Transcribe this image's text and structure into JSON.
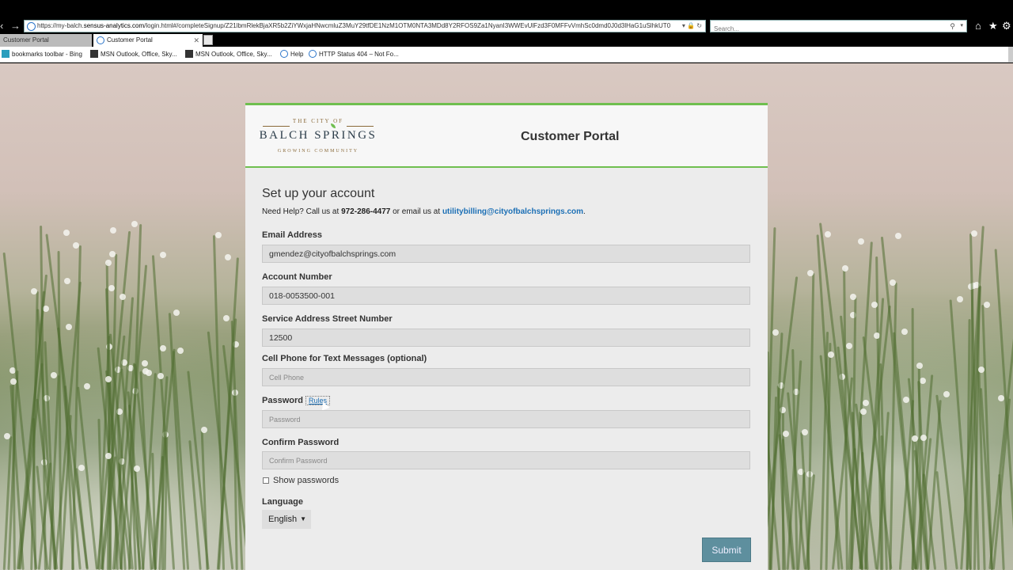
{
  "browser": {
    "url_prefix": "https://my-balch.",
    "url_domain": "sensus-analytics.com",
    "url_path": "/login.html#/completeSignup/Z21lbmRlekBjaXR5b2ZiYWxjaHNwcmluZ3MuY29tfDE1NzM1OTM0NTA3MDd8Y2RFOS9Za1NyanI3WWEvUlFzd3F0MFFvVmhSc0dmd0J0d3lHaG1uSlhkUT0",
    "search_placeholder": "Search...",
    "tabs": [
      {
        "label": "Customer Portal",
        "active": false
      },
      {
        "label": "Customer Portal",
        "active": true
      }
    ],
    "favorites": [
      {
        "label": "bookmarks toolbar - Bing",
        "icon": "bing-icon"
      },
      {
        "label": "MSN Outlook, Office, Sky...",
        "icon": "msn-icon"
      },
      {
        "label": "MSN Outlook, Office, Sky...",
        "icon": "msn-icon"
      },
      {
        "label": "Help",
        "icon": "ie-icon"
      },
      {
        "label": "HTTP Status 404 – Not Fo...",
        "icon": "ie-icon"
      }
    ]
  },
  "header": {
    "logo_top": "THE CITY OF",
    "logo_name": "BALCH SPRINGS",
    "logo_sub": "GROWING COMMUNITY",
    "portal_title": "Customer Portal"
  },
  "form": {
    "title": "Set up your account",
    "help_prefix": "Need Help? Call us at ",
    "help_phone": "972-286-4477",
    "help_mid": " or email us at ",
    "help_email": "utilitybilling@cityofbalchsprings.com",
    "help_suffix": ".",
    "email_label": "Email Address",
    "email_value": "gmendez@cityofbalchsprings.com",
    "account_label": "Account Number",
    "account_value": "018-0053500-001",
    "street_label": "Service Address Street Number",
    "street_value": "12500",
    "phone_label": "Cell Phone for Text Messages (optional)",
    "phone_placeholder": "Cell Phone",
    "password_label": "Password",
    "rules_label": "Rules",
    "password_placeholder": "Password",
    "confirm_label": "Confirm Password",
    "confirm_placeholder": "Confirm Password",
    "show_passwords_label": "Show passwords",
    "language_label": "Language",
    "language_value": "English",
    "submit_label": "Submit"
  },
  "colors": {
    "accent_green": "#6fbf4f",
    "link_blue": "#1b6fb5",
    "submit_bg": "#5e8f9e"
  }
}
